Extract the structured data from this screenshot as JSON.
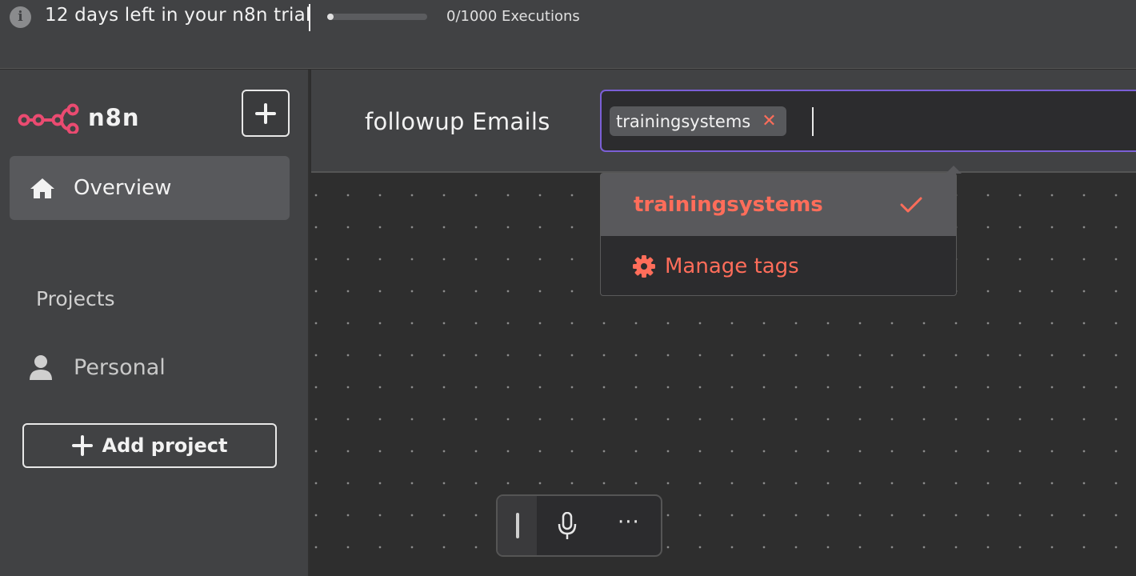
{
  "banner": {
    "trial_text": "12 days left in your n8n trial",
    "executions_text": "0/1000 Executions",
    "executions_used_fraction": 0.0
  },
  "sidebar": {
    "logo_text": "n8n",
    "overview_label": "Overview",
    "projects_heading": "Projects",
    "personal_label": "Personal",
    "add_project_label": "Add project"
  },
  "header": {
    "workflow_name": "followup Emails",
    "tags": [
      {
        "label": "trainingsystems"
      }
    ]
  },
  "tag_dropdown": {
    "items": [
      {
        "label": "trainingsystems",
        "selected": true
      }
    ],
    "manage_label": "Manage tags"
  },
  "colors": {
    "accent": "#ff6d5a",
    "focus_border": "#7b5fd6",
    "logo": "#ea4b71"
  },
  "icons": {
    "info": "info-icon",
    "new": "plus-icon",
    "overview": "house-icon",
    "personal": "user-icon",
    "selected": "check-icon",
    "manage": "gear-icon",
    "mic": "microphone-icon",
    "more": "more-icon"
  }
}
